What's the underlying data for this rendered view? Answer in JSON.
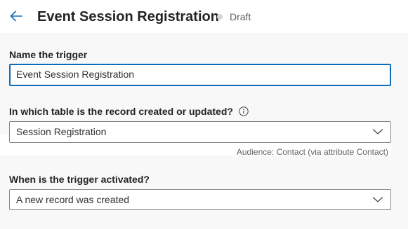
{
  "header": {
    "title": "Event Session Registration",
    "status": "Draft",
    "back_icon": "arrow-left-icon"
  },
  "form": {
    "name": {
      "label": "Name the trigger",
      "value": "Event Session Registration"
    },
    "table": {
      "label": "In which table is the record created or updated?",
      "info_icon": "info-icon",
      "value": "Session Registration",
      "caption": "Audience: Contact (via attribute Contact)"
    },
    "activation": {
      "label": "When is the trigger activated?",
      "value": "A new record was created"
    }
  },
  "colors": {
    "accent": "#0f6cbd",
    "background": "#f8f8f8",
    "text": "#242424"
  }
}
